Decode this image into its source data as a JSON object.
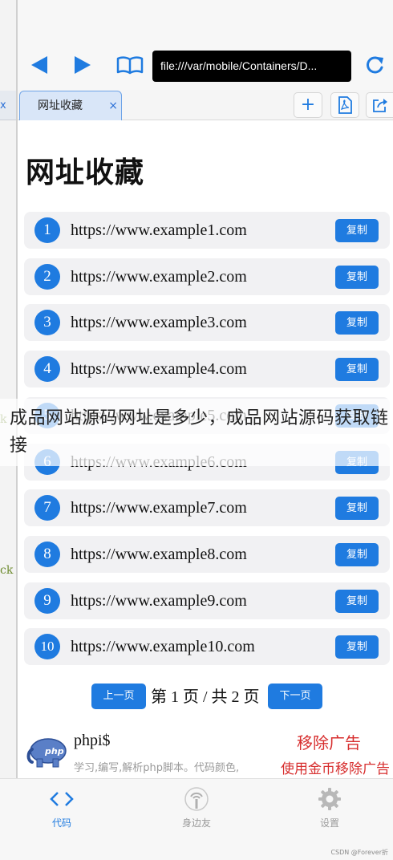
{
  "toolbar": {
    "url": "file:///var/mobile/Containers/D...",
    "back_icon": "back-arrow-icon",
    "forward_icon": "forward-arrow-icon",
    "bookmarks_icon": "book-icon",
    "reload_icon": "reload-icon"
  },
  "tabs": {
    "active_label": "网址收藏",
    "close_glyph": "×",
    "add_glyph": "+"
  },
  "left_peek": {
    "tab_glyph": "x",
    "text1": "k",
    "text2": "ck"
  },
  "page": {
    "title": "网址收藏",
    "rows": [
      {
        "num": "1",
        "url": "https://www.example1.com",
        "copy": "复制"
      },
      {
        "num": "2",
        "url": "https://www.example2.com",
        "copy": "复制"
      },
      {
        "num": "3",
        "url": "https://www.example3.com",
        "copy": "复制"
      },
      {
        "num": "4",
        "url": "https://www.example4.com",
        "copy": "复制"
      },
      {
        "num": "5",
        "url": "https://www.example5.com",
        "copy": "复制"
      },
      {
        "num": "6",
        "url": "https://www.example6.com",
        "copy": "复制"
      },
      {
        "num": "7",
        "url": "https://www.example7.com",
        "copy": "复制"
      },
      {
        "num": "8",
        "url": "https://www.example8.com",
        "copy": "复制"
      },
      {
        "num": "9",
        "url": "https://www.example9.com",
        "copy": "复制"
      },
      {
        "num": "10",
        "url": "https://www.example10.com",
        "copy": "复制"
      }
    ],
    "pager": {
      "prev": "上一页",
      "status": "第 1 页 / 共 2 页",
      "next": "下一页"
    }
  },
  "ad": {
    "logo_text": "php",
    "name": "phpi$",
    "description": "学习,编写,解析php脚本。代码颜色,",
    "remove": "移除广告",
    "coin_remove": "使用金币移除广告"
  },
  "overlay": {
    "caption": "成品网站源码网址是多少，成品网站源码获取链接"
  },
  "bottom_tabs": [
    {
      "label": "代码",
      "icon": "code-brackets-icon",
      "active": true
    },
    {
      "label": "身边友",
      "icon": "nearby-broadcast-icon",
      "active": false
    },
    {
      "label": "设置",
      "icon": "gear-icon",
      "active": false
    }
  ],
  "watermark": "CSDN @Forever折",
  "colors": {
    "accent": "#1f7be0",
    "danger": "#d72e2e",
    "inactive": "#9a9a9a"
  }
}
